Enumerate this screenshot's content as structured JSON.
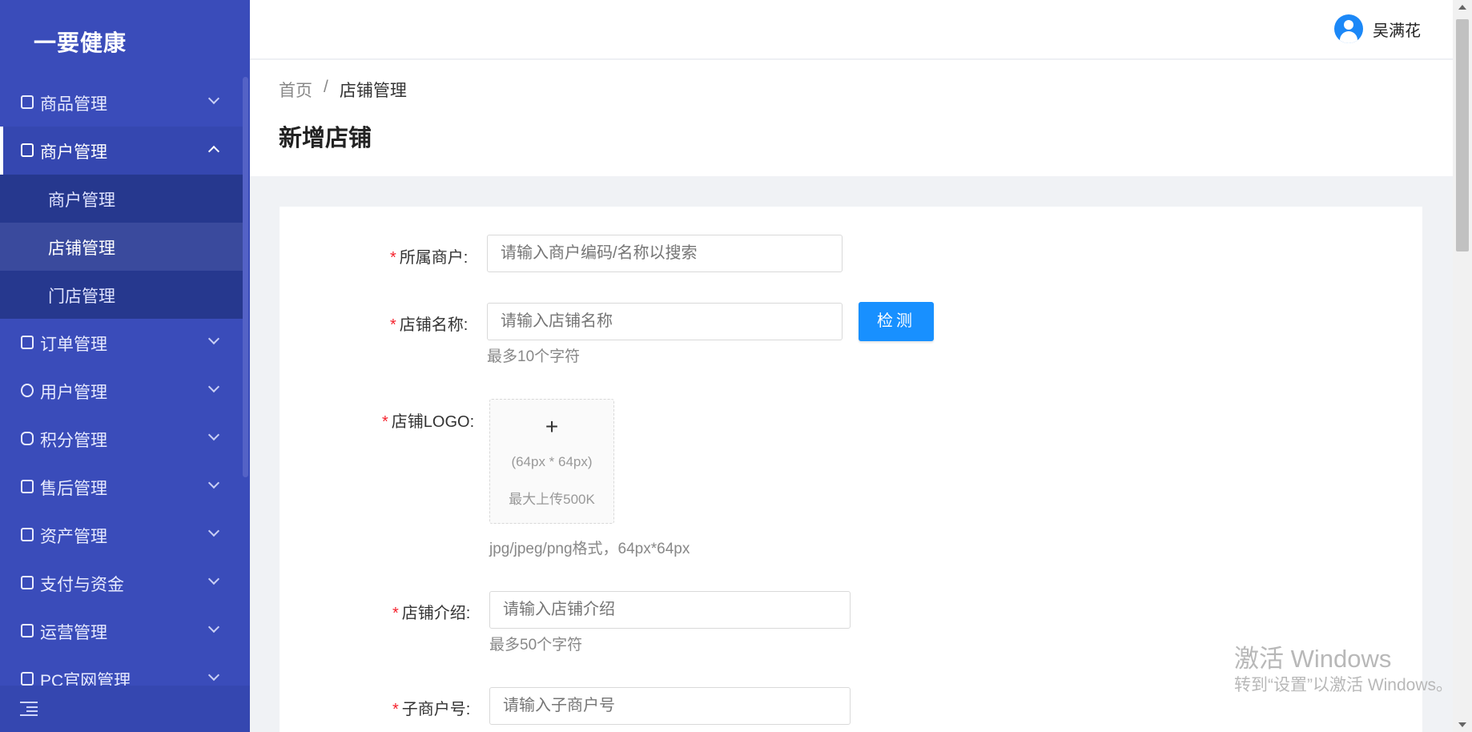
{
  "app": {
    "name": "一要健康"
  },
  "sidebar": {
    "items": [
      {
        "label": "商品管理"
      },
      {
        "label": "商户管理"
      },
      {
        "label": "订单管理"
      },
      {
        "label": "用户管理"
      },
      {
        "label": "积分管理"
      },
      {
        "label": "售后管理"
      },
      {
        "label": "资产管理"
      },
      {
        "label": "支付与资金"
      },
      {
        "label": "运营管理"
      },
      {
        "label": "PC官网管理"
      }
    ],
    "submenu": [
      {
        "label": "商户管理"
      },
      {
        "label": "店铺管理"
      },
      {
        "label": "门店管理"
      }
    ]
  },
  "header": {
    "username": "吴满花"
  },
  "breadcrumb": {
    "home": "首页",
    "separator": "/",
    "current": "店铺管理"
  },
  "page": {
    "title": "新增店铺"
  },
  "form": {
    "merchant": {
      "label": "所属商户:",
      "placeholder": "请输入商户编码/名称以搜索"
    },
    "shop_name": {
      "label": "店铺名称:",
      "placeholder": "请输入店铺名称",
      "hint": "最多10个字符",
      "check_button": "检测"
    },
    "logo": {
      "label": "店铺LOGO:",
      "size_text": "(64px * 64px)",
      "max_text": "最大上传500K",
      "hint": "jpg/jpeg/png格式，64px*64px"
    },
    "intro": {
      "label": "店铺介绍:",
      "placeholder": "请输入店铺介绍",
      "hint": "最多50个字符"
    },
    "sub_merchant": {
      "label": "子商户号:",
      "placeholder": "请输入子商户号"
    }
  },
  "watermark": {
    "title": "激活 Windows",
    "subtitle": "转到“设置”以激活 Windows。"
  },
  "colors": {
    "sidebar": "#3a4cba",
    "submenu": "#26388e",
    "primary": "#1890ff",
    "required": "#f5222d"
  }
}
